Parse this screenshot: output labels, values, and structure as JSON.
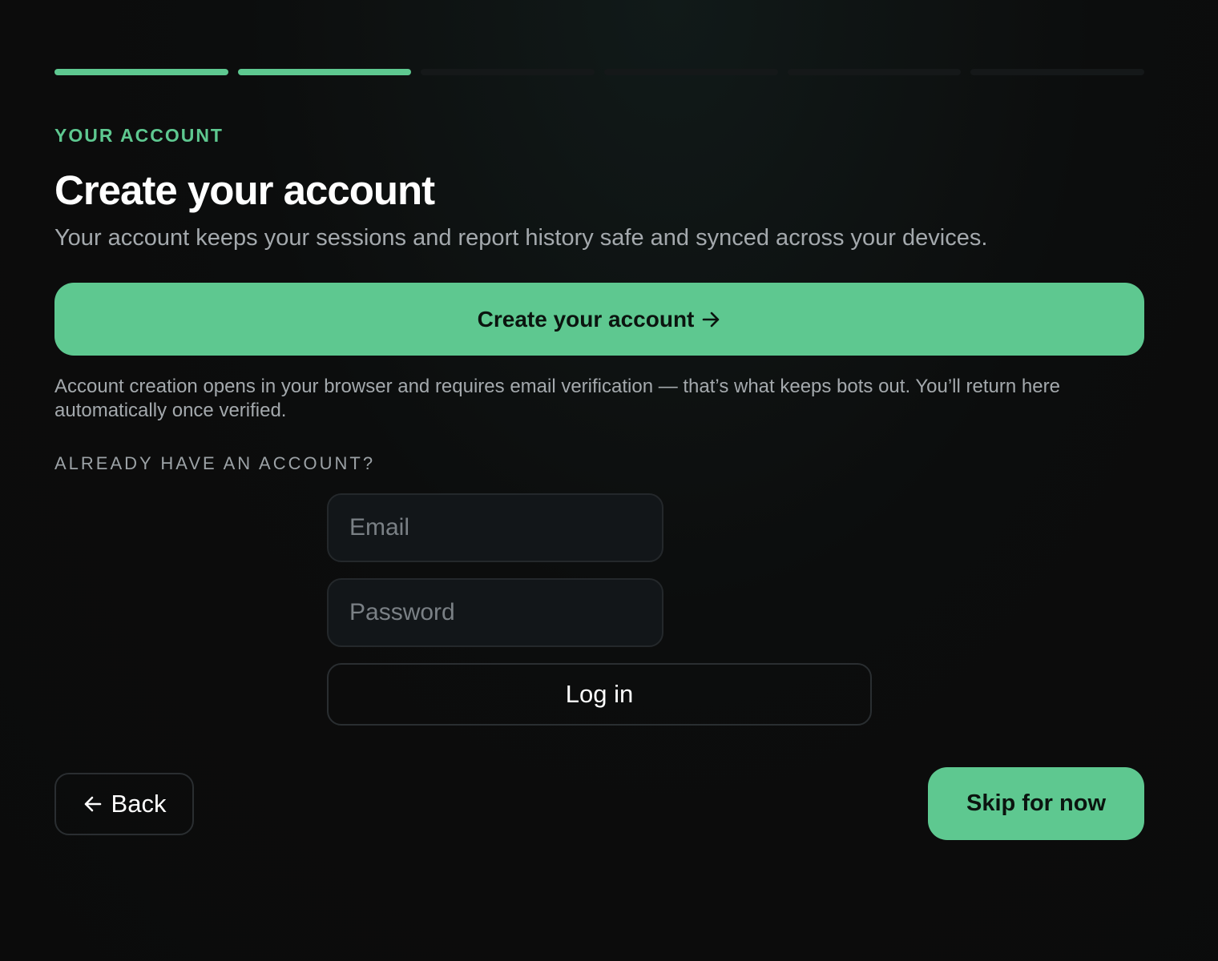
{
  "progress": {
    "total_steps": 6,
    "completed_steps": 2,
    "active_color": "#5ec890",
    "inactive_color": "#151819"
  },
  "step": {
    "eyebrow": "YOUR ACCOUNT",
    "title": "Create your account",
    "subtitle": "Your account keeps your sessions and report history safe and synced across your devices."
  },
  "create_account": {
    "label": "Create your account",
    "icon": "arrow-right-icon"
  },
  "note": "Account creation opens in your browser and requires email verification — that’s what keeps bots out. You’ll return here automatically once verified.",
  "login": {
    "section_label": "ALREADY HAVE AN ACCOUNT?",
    "email_placeholder": "Email",
    "password_placeholder": "Password",
    "button_label": "Log in"
  },
  "footer": {
    "back_label": "Back",
    "back_icon": "arrow-left-icon",
    "skip_label": "Skip for now"
  },
  "colors": {
    "accent": "#5ec890",
    "background": "#0b0b0b",
    "muted_text": "#a4a9ad"
  }
}
